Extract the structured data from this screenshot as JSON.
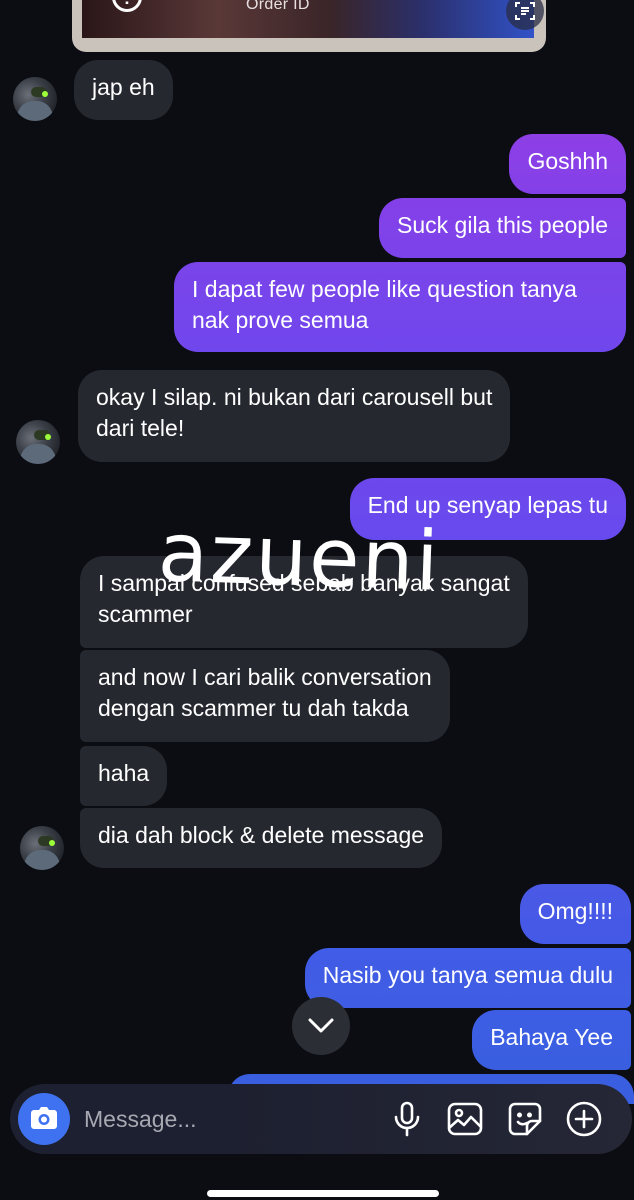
{
  "top_image": {
    "label": "Order ID",
    "info_glyph": "!",
    "icons": [
      "info-icon",
      "scan-text-icon"
    ]
  },
  "messages": [
    {
      "side": "received",
      "text": "jap eh"
    },
    {
      "side": "sent",
      "text": "Goshhh"
    },
    {
      "side": "sent",
      "text": "Suck gila this people"
    },
    {
      "side": "sent",
      "text": "I dapat few people like question tanya\nnak prove semua"
    },
    {
      "side": "received",
      "text": "okay I silap. ni bukan dari carousell but\ndari tele!"
    },
    {
      "side": "sent",
      "text": "End up senyap lepas tu"
    },
    {
      "side": "received",
      "text": "I sampai confused sebab banyak sangat\nscammer"
    },
    {
      "side": "received",
      "text": "and now I cari balik conversation\ndengan scammer tu dah takda"
    },
    {
      "side": "received",
      "text": "haha"
    },
    {
      "side": "received",
      "text": "dia dah block & delete message"
    },
    {
      "side": "sent",
      "text": "Omg!!!!"
    },
    {
      "side": "sent",
      "text": "Nasib you tanya semua dulu"
    },
    {
      "side": "sent",
      "text": "Bahaya Yee"
    }
  ],
  "watermark": "azueni",
  "composer": {
    "placeholder": "Message...",
    "icons": [
      "camera-icon",
      "microphone-icon",
      "gallery-icon",
      "sticker-icon",
      "add-icon"
    ]
  },
  "colors": {
    "background": "#0b0d12",
    "received_bubble": "#262830",
    "sent_gradient_top": "#8a3fe8",
    "sent_gradient_mid": "#6a4ff0",
    "sent_gradient_bottom": "#3a5ee0",
    "camera_button": "#3f72f0"
  }
}
